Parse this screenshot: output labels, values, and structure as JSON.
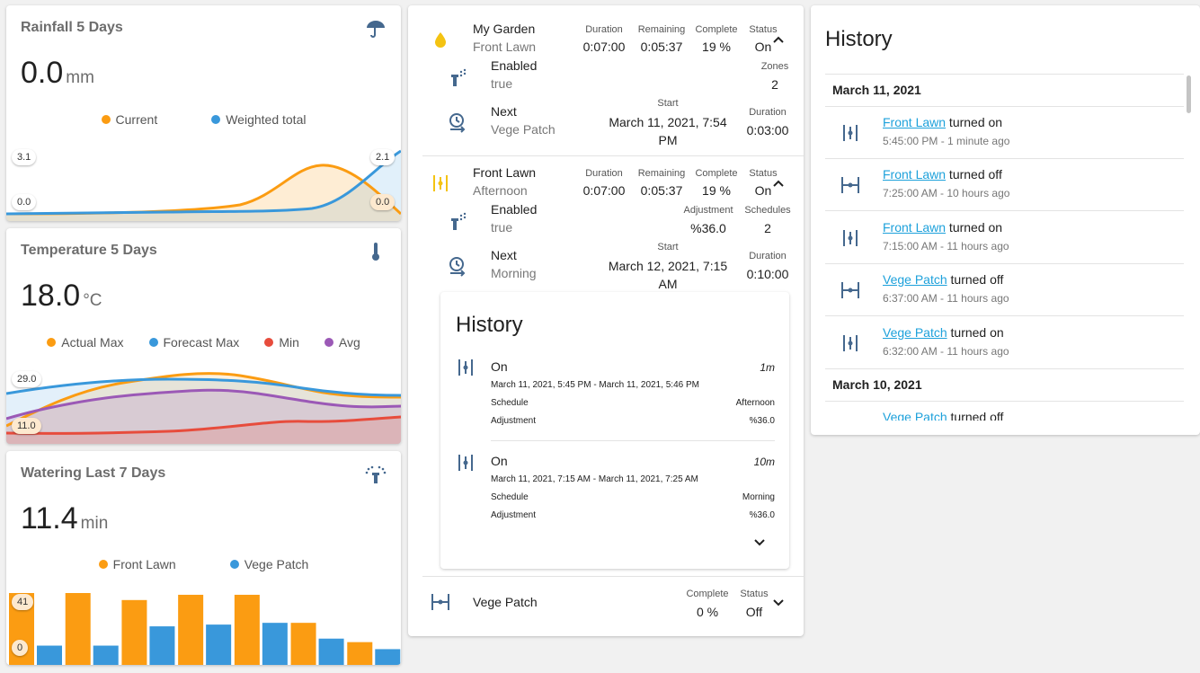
{
  "colors": {
    "orange": "#fb9c12",
    "blue": "#3998db",
    "red": "#e74c3c",
    "purple": "#9b59b6",
    "yellow": "#f4c312",
    "icon": "#45688e",
    "link": "#1da1db"
  },
  "rainfall": {
    "title": "Rainfall 5 Days",
    "value": "0.0",
    "unit": "mm",
    "icon": "umbrella-icon",
    "legend": [
      "Current",
      "Weighted total"
    ],
    "left_max": "3.1",
    "left_min": "0.0",
    "right_max": "2.1",
    "right_min": "0.0"
  },
  "temperature": {
    "title": "Temperature 5 Days",
    "value": "18.0",
    "unit": "°C",
    "icon": "thermometer-icon",
    "legend": [
      "Actual Max",
      "Forecast Max",
      "Min",
      "Avg"
    ],
    "max_label": "29.0",
    "min_label": "11.0"
  },
  "watering": {
    "title": "Watering Last 7 Days",
    "value": "11.4",
    "unit": "min",
    "icon": "sprinkler-icon",
    "legend": [
      "Front Lawn",
      "Vege Patch"
    ],
    "max_label": "41",
    "min_label": "0"
  },
  "chart_data": [
    {
      "type": "area",
      "title": "Rainfall 5 Days",
      "series": [
        {
          "name": "Current",
          "values": [
            0.0,
            0.0,
            0.0,
            0.1,
            0.1,
            0.2,
            1.2,
            2.7,
            2.1,
            0.0
          ]
        },
        {
          "name": "Weighted total",
          "values": [
            0.0,
            0.0,
            0.0,
            0.0,
            0.0,
            0.0,
            0.0,
            0.2,
            0.9,
            2.1
          ]
        }
      ],
      "ylim_left": [
        0.0,
        3.1
      ],
      "ylim_right": [
        0.0,
        2.1
      ]
    },
    {
      "type": "area",
      "title": "Temperature 5 Days",
      "series": [
        {
          "name": "Actual Max",
          "values": [
            11.0,
            19.0,
            23.0,
            25.0,
            27.0,
            25.0,
            23.0,
            22.0,
            22.0
          ]
        },
        {
          "name": "Forecast Max",
          "values": [
            24.0,
            25.5,
            26.5,
            26.5,
            25.5,
            24.5,
            23.0,
            22.5,
            22.5
          ]
        },
        {
          "name": "Min",
          "values": [
            11.5,
            11.5,
            12.0,
            12.5,
            12.5,
            12.0,
            12.5,
            13.0,
            13.5
          ]
        },
        {
          "name": "Avg",
          "values": [
            15.0,
            19.0,
            21.0,
            23.0,
            22.0,
            19.5,
            19.0,
            19.0,
            19.0
          ]
        }
      ],
      "ylim": [
        11.0,
        29.0
      ]
    },
    {
      "type": "bar",
      "title": "Watering Last 7 Days",
      "series": [
        {
          "name": "Front Lawn",
          "values": [
            41,
            41,
            37,
            40,
            40,
            24,
            13
          ]
        },
        {
          "name": "Vege Patch",
          "values": [
            11,
            11,
            22,
            23,
            24,
            15,
            9
          ]
        }
      ],
      "ylim": [
        0,
        41
      ]
    }
  ],
  "zones": {
    "controller": {
      "name": "My Garden",
      "zone": "Front Lawn",
      "icon": "water-drop-icon",
      "duration_label": "Duration",
      "duration": "0:07:00",
      "remaining_label": "Remaining",
      "remaining": "0:05:37",
      "complete_label": "Complete",
      "complete": "19 %",
      "status_label": "Status",
      "status": "On",
      "enabled_label": "Enabled",
      "enabled": "true",
      "zones_label": "Zones",
      "zones": "2",
      "next_label": "Next",
      "next": "Vege Patch",
      "start_label": "Start",
      "start": "March 11, 2021, 7:54 PM",
      "next_duration_label": "Duration",
      "next_duration": "0:03:00"
    },
    "front_lawn": {
      "name": "Front Lawn",
      "sub": "Afternoon",
      "duration_label": "Duration",
      "duration": "0:07:00",
      "remaining_label": "Remaining",
      "remaining": "0:05:37",
      "complete_label": "Complete",
      "complete": "19 %",
      "status_label": "Status",
      "status": "On",
      "enabled_label": "Enabled",
      "enabled": "true",
      "adjustment_label": "Adjustment",
      "adjustment": "%36.0",
      "schedules_label": "Schedules",
      "schedules": "2",
      "next_label": "Next",
      "next": "Morning",
      "start_label": "Start",
      "start": "March 12, 2021, 7:15 AM",
      "next_duration_label": "Duration",
      "next_duration": "0:10:00"
    },
    "inner_history": {
      "title": "History",
      "entries": [
        {
          "state": "On",
          "duration": "1m",
          "range": "March 11, 2021, 5:45 PM - March 11, 2021, 5:46 PM",
          "schedule_label": "Schedule",
          "schedule": "Afternoon",
          "adjustment_label": "Adjustment",
          "adjustment": "%36.0"
        },
        {
          "state": "On",
          "duration": "10m",
          "range": "March 11, 2021, 7:15 AM - March 11, 2021, 7:25 AM",
          "schedule_label": "Schedule",
          "schedule": "Morning",
          "adjustment_label": "Adjustment",
          "adjustment": "%36.0"
        }
      ]
    },
    "vege_patch": {
      "name": "Vege Patch",
      "complete_label": "Complete",
      "complete": "0 %",
      "status_label": "Status",
      "status": "Off"
    }
  },
  "history": {
    "title": "History",
    "date1": "March 11, 2021",
    "date2": "March 10, 2021",
    "items": [
      {
        "link": "Front Lawn",
        "action": " turned on",
        "time": "5:45:00 PM - 1 minute ago",
        "icon": "valve-open-icon"
      },
      {
        "link": "Front Lawn",
        "action": " turned off",
        "time": "7:25:00 AM - 10 hours ago",
        "icon": "valve-closed-icon"
      },
      {
        "link": "Front Lawn",
        "action": " turned on",
        "time": "7:15:00 AM - 11 hours ago",
        "icon": "valve-open-icon"
      },
      {
        "link": "Vege Patch",
        "action": " turned off",
        "time": "6:37:00 AM - 11 hours ago",
        "icon": "valve-closed-icon"
      },
      {
        "link": "Vege Patch",
        "action": " turned on",
        "time": "6:32:00 AM - 11 hours ago",
        "icon": "valve-open-icon"
      },
      {
        "link": "Vege Patch",
        "action": " turned off",
        "time": "",
        "icon": "valve-closed-icon"
      }
    ]
  }
}
